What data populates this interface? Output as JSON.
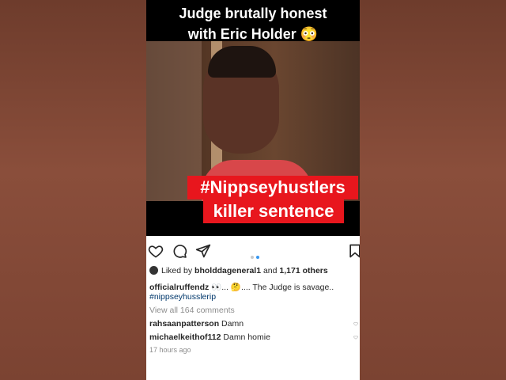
{
  "video": {
    "title_line1": "Judge brutally honest",
    "title_line2": "with Eric Holder 😳",
    "caption_line1": "#Nippseyhustlers",
    "caption_line2": "killer sentence"
  },
  "likes": {
    "prefix": "Liked by",
    "user": "bholddageneral1",
    "middle": "and",
    "count": "1,171 others"
  },
  "post": {
    "author": "officialruffendz",
    "text": "👀... 🤔.... The Judge is savage..",
    "hashtag": "#nippseyhusslerip"
  },
  "view_comments": "View all 164 comments",
  "comments": [
    {
      "user": "rahsaanpatterson",
      "text": "Damn"
    },
    {
      "user": "michaelkeithof112",
      "text": "Damn homie"
    }
  ],
  "timestamp": "17 hours ago",
  "colors": {
    "accent": "#3897f0",
    "caption_red": "#e8161d"
  }
}
